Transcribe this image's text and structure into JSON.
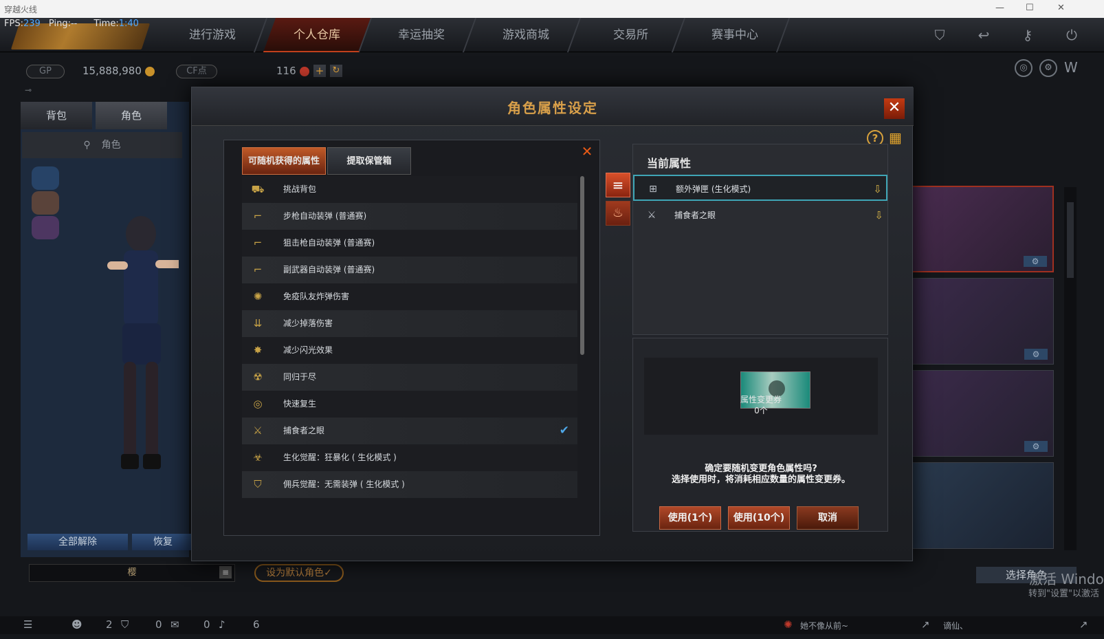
{
  "window": {
    "title": "穿越火线",
    "controls": [
      "—",
      "☐",
      "✕"
    ]
  },
  "hud": {
    "fps_label": "FPS:",
    "fps": "239",
    "ping_label": "Ping:",
    "ping": "--",
    "time_label": "Time:",
    "time": "1:40"
  },
  "nav": {
    "tabs": [
      "进行游戏",
      "个人仓库",
      "幸运抽奖",
      "游戏商城",
      "交易所",
      "赛事中心"
    ],
    "active": "个人仓库"
  },
  "currency": {
    "gp_label": "GP",
    "gp_value": "15,888,980",
    "cf_label": "CF点",
    "cf_value": "116"
  },
  "left": {
    "tabs": [
      "背包",
      "角色"
    ],
    "char_button": "角色",
    "unequip_all": "全部解除",
    "restore": "恢复",
    "name_field": "樱",
    "set_default": "设为默认角色✓"
  },
  "modal": {
    "title": "角色属性设定",
    "tabs": [
      "可随机获得的属性",
      "提取保管箱"
    ],
    "attributes": [
      {
        "label": "挑战背包",
        "icon": "backpack-icon",
        "checked": false
      },
      {
        "label": "步枪自动装弹 (普通赛)",
        "icon": "rifle-icon",
        "checked": false
      },
      {
        "label": "狙击枪自动装弹 (普通赛)",
        "icon": "sniper-icon",
        "checked": false
      },
      {
        "label": "副武器自动装弹 (普通赛)",
        "icon": "pistol-icon",
        "checked": false
      },
      {
        "label": "免疫队友炸弹伤害",
        "icon": "explosion-icon",
        "checked": false
      },
      {
        "label": "减少掉落伤害",
        "icon": "fall-icon",
        "checked": false
      },
      {
        "label": "减少闪光效果",
        "icon": "flash-icon",
        "checked": false
      },
      {
        "label": "同归于尽",
        "icon": "bomb-icon",
        "checked": false
      },
      {
        "label": "快速复生",
        "icon": "respawn-icon",
        "checked": false
      },
      {
        "label": "捕食者之眼",
        "icon": "claw-icon",
        "checked": true
      },
      {
        "label": "生化觉醒：狂暴化 ( 生化模式 )",
        "icon": "berserk-icon",
        "checked": false
      },
      {
        "label": "佣兵觉醒：无需装弹 ( 生化模式 )",
        "icon": "shield-icon",
        "checked": false
      }
    ],
    "current_title": "当前属性",
    "current": [
      {
        "label": "额外弹匣 (生化模式)",
        "icon": "magazine-icon"
      },
      {
        "label": "捕食者之眼",
        "icon": "claw-icon"
      }
    ],
    "voucher_name": "属性变更券",
    "voucher_count": "0个",
    "confirm_line1": "确定要随机变更角色属性吗?",
    "confirm_line2": "选择使用时，将消耗相应数量的属性变更券。",
    "btn_use1": "使用(1个)",
    "btn_use10": "使用(10个)",
    "btn_cancel": "取消"
  },
  "right": {
    "select_char": "选择角色"
  },
  "bottom": {
    "counts": [
      "2",
      "0",
      "0",
      "6"
    ],
    "chat_text": "她不像从前~",
    "chat_text2": "谪仙、"
  },
  "watermark": {
    "line1": "激活 Windo",
    "line2": "转到\"设置\"以激活"
  },
  "colors": {
    "accent": "#d9a04a",
    "active_tab": "#c05a28",
    "highlight": "#3fa6b6",
    "check": "#4fa8e8"
  }
}
